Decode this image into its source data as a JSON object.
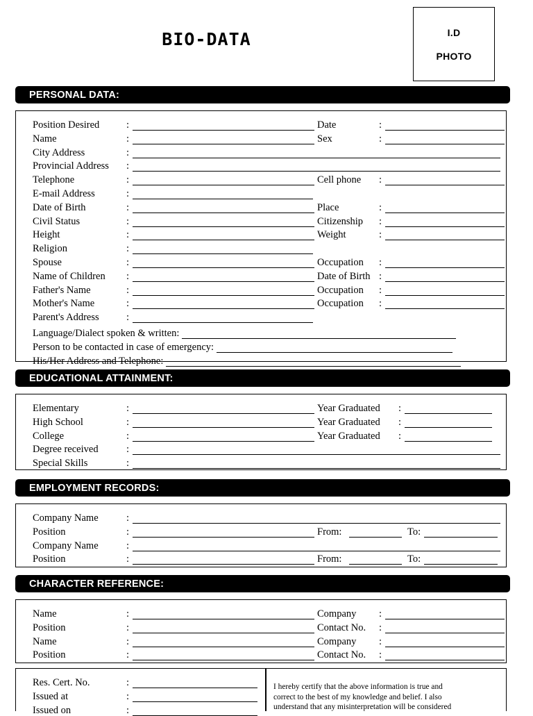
{
  "document": {
    "title": "BIO-DATA",
    "id_photo": {
      "line1": "I.D",
      "line2": "PHOTO"
    }
  },
  "sections": {
    "personal": {
      "heading": "PERSONAL DATA:"
    },
    "education": {
      "heading": "EDUCATIONAL ATTAINMENT:"
    },
    "employment": {
      "heading": "EMPLOYMENT RECORDS:"
    },
    "character": {
      "heading": "CHARACTER REFERENCE:"
    }
  },
  "personal_rows": [
    {
      "left": "Position Desired",
      "right": "Date"
    },
    {
      "left": "Name",
      "right": "Sex"
    },
    {
      "left": "City Address",
      "right": ""
    },
    {
      "left": "Provincial Address",
      "right": ""
    },
    {
      "left": "Telephone",
      "right": "Cell phone"
    },
    {
      "left": "E-mail Address",
      "right": ""
    },
    {
      "left": "Date of Birth",
      "right": "Place"
    },
    {
      "left": "Civil Status",
      "right": "Citizenship"
    },
    {
      "left": "Height",
      "right": "Weight"
    },
    {
      "left": "Religion",
      "right": ""
    },
    {
      "left": "Spouse",
      "right": "Occupation"
    },
    {
      "left": "Name of Children",
      "right": "Date of Birth"
    },
    {
      "left": "Father's Name",
      "right": "Occupation"
    },
    {
      "left": "Mother's Name",
      "right": "Occupation"
    },
    {
      "left": "Parent's Address",
      "right": ""
    }
  ],
  "personal_wide_rows": [
    {
      "label": "Language/Dialect spoken & written:"
    },
    {
      "label": "Person to be contacted in case of emergency:"
    },
    {
      "label": "His/Her Address and Telephone:"
    }
  ],
  "education_rows": [
    {
      "left": "Elementary",
      "right": "Year Graduated"
    },
    {
      "left": "High School",
      "right": "Year Graduated"
    },
    {
      "left": "College",
      "right": "Year Graduated"
    },
    {
      "left": "Degree received",
      "right": ""
    },
    {
      "left": "Special Skills",
      "right": ""
    }
  ],
  "employment_rows": [
    {
      "left": "Company Name",
      "from": "",
      "to": ""
    },
    {
      "left": "Position",
      "from": "From:",
      "to": "To:"
    },
    {
      "left": "Company Name",
      "from": "",
      "to": ""
    },
    {
      "left": "Position",
      "from": "From:",
      "to": "To:"
    }
  ],
  "character_rows": [
    {
      "left": "Name",
      "right": "Company"
    },
    {
      "left": "Position",
      "right": "Contact No."
    },
    {
      "left": "Name",
      "right": "Company"
    },
    {
      "left": "Position",
      "right": "Contact No."
    }
  ],
  "residence_rows": [
    {
      "label": "Res. Cert. No."
    },
    {
      "label": "Issued at"
    },
    {
      "label": "Issued on"
    }
  ],
  "certification": {
    "line1": "I hereby certify that the above information is true and",
    "line2": "correct to the best of my knowledge and belief. I also",
    "line3": "understand that any misinterpretation will be considered"
  },
  "colon": ":",
  "colors": {
    "bar_background": "#000000",
    "bar_text": "#ffffff",
    "page": "#ffffff"
  }
}
